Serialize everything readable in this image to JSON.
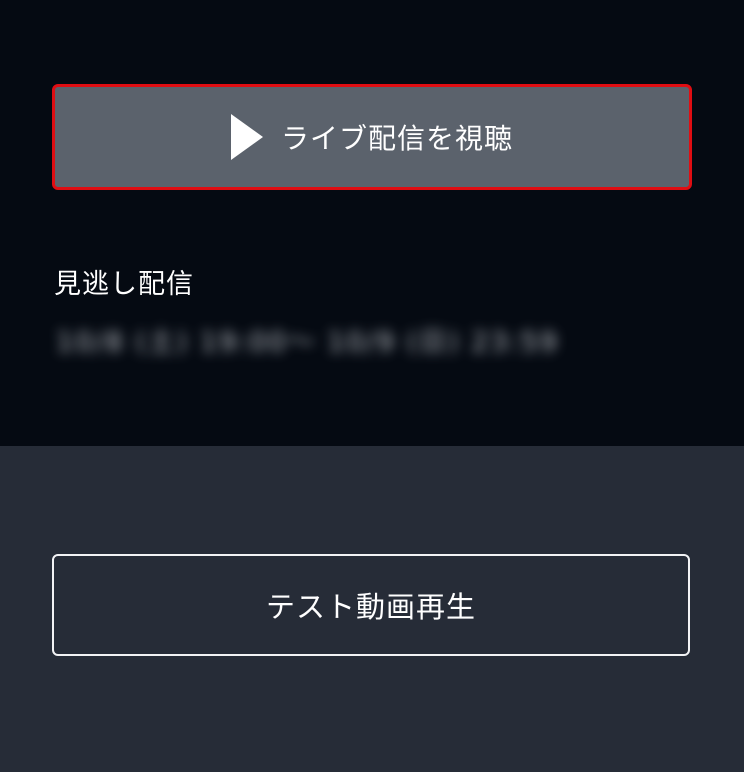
{
  "live": {
    "button_label": "ライブ配信を視聴",
    "icon": "play-icon"
  },
  "missed": {
    "title": "見逃し配信",
    "info": "10/8 (土) 19:00〜 10/9 (日) 23:59"
  },
  "test": {
    "button_label": "テスト動画再生"
  },
  "colors": {
    "top_background": "#050a12",
    "bottom_background": "#262c37",
    "live_button_background": "#5b626c",
    "live_button_border": "#e00d12"
  }
}
